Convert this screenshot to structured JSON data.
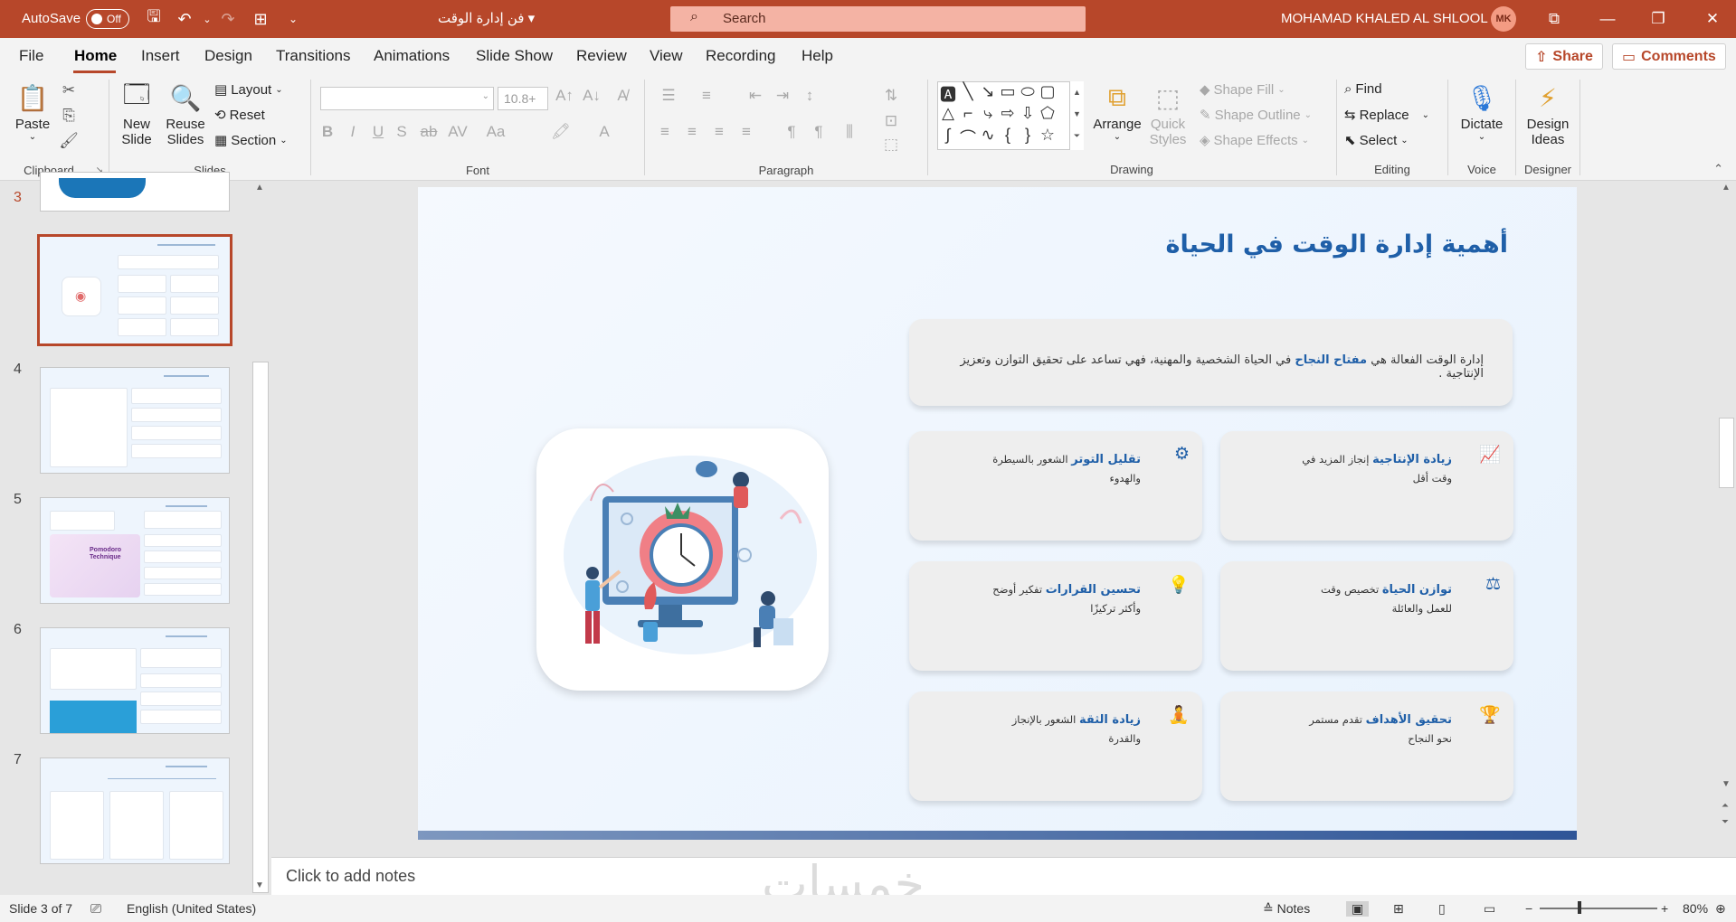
{
  "titlebar": {
    "autosave_label": "AutoSave",
    "autosave_state": "Off",
    "doc_title": "فن إدارة الوقت",
    "search_placeholder": "Search",
    "user_name": "MOHAMAD KHALED AL SHLOOL",
    "user_initials": "MK"
  },
  "menu": {
    "items": [
      "File",
      "Home",
      "Insert",
      "Design",
      "Transitions",
      "Animations",
      "Slide Show",
      "Review",
      "View",
      "Recording",
      "Help"
    ],
    "share": "Share",
    "comments": "Comments"
  },
  "ribbon": {
    "clipboard": {
      "paste": "Paste",
      "label": "Clipboard"
    },
    "slides": {
      "new_slide_1": "New",
      "new_slide_2": "Slide",
      "reuse_1": "Reuse",
      "reuse_2": "Slides",
      "layout": "Layout",
      "reset": "Reset",
      "section": "Section",
      "label": "Slides"
    },
    "font": {
      "size": "10.8+",
      "label": "Font"
    },
    "paragraph": {
      "label": "Paragraph"
    },
    "drawing": {
      "arrange": "Arrange",
      "quick_styles_1": "Quick",
      "quick_styles_2": "Styles",
      "shape_fill": "Shape Fill",
      "shape_outline": "Shape Outline",
      "shape_effects": "Shape Effects",
      "label": "Drawing"
    },
    "editing": {
      "find": "Find",
      "replace": "Replace",
      "select": "Select",
      "label": "Editing"
    },
    "voice": {
      "dictate": "Dictate",
      "label": "Voice"
    },
    "designer": {
      "ideas_1": "Design",
      "ideas_2": "Ideas",
      "label": "Designer"
    }
  },
  "thumbnails": {
    "numbers": [
      "3",
      "4",
      "5",
      "6",
      "7"
    ],
    "pomodoro_1": "Pomodoro",
    "pomodoro_2": "Technique"
  },
  "slide": {
    "title": "أهمية إدارة الوقت في الحياة",
    "intro_pre": "إدارة الوقت الفعالة هي ",
    "intro_bold": "مفتاح النجاح",
    "intro_post": " في الحياة الشخصية والمهنية، فهي تساعد على تحقيق التوازن وتعزيز الإنتاجية .",
    "cards": [
      {
        "title": "زيادة الإنتاجية",
        "text": " إنجاز المزيد في وقت أقل",
        "icon": "trend-up-icon"
      },
      {
        "title": "تقليل التوتر",
        "text": " الشعور بالسيطرة والهدوء",
        "icon": "gear-icon"
      },
      {
        "title": "توازن الحياة",
        "text": " تخصيص وقت للعمل والعائلة",
        "icon": "scale-icon"
      },
      {
        "title": "تحسين القرارات",
        "text": " تفكير أوضح وأكثر تركيزًا",
        "icon": "lightbulb-icon"
      },
      {
        "title": "تحقيق الأهداف",
        "text": " تقدم مستمر نحو النجاح",
        "icon": "trophy-icon"
      },
      {
        "title": "زيادة الثقة",
        "text": " الشعور بالإنجاز والقدرة",
        "icon": "person-icon"
      }
    ]
  },
  "notes_placeholder": "Click to add notes",
  "watermark": "خمسات",
  "status": {
    "slide_info": "Slide 3 of 7",
    "language": "English (United States)",
    "notes": "Notes",
    "zoom": "80%"
  }
}
